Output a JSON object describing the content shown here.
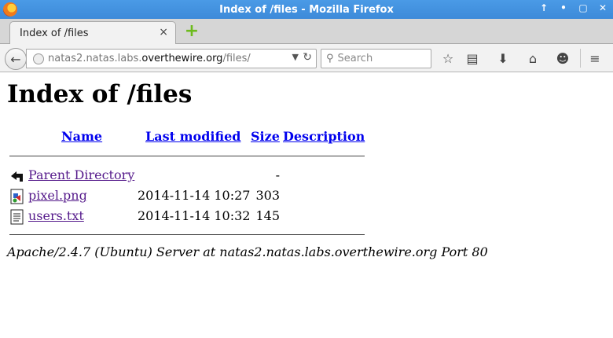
{
  "window": {
    "title": "Index of /files - Mozilla Firefox",
    "buttons": [
      "↑",
      "•",
      "▢",
      "✕"
    ]
  },
  "tab": {
    "label": "Index of /files",
    "close": "×",
    "newtab": "+"
  },
  "navbar": {
    "url_prefix": "natas2.natas.labs.",
    "url_host": "overthewire.org",
    "url_path": "/files/",
    "search_placeholder": "Search"
  },
  "page": {
    "title": "Index of /files",
    "columns": {
      "name": "Name",
      "modified": "Last modified",
      "size": "Size",
      "description": "Description"
    },
    "rows": [
      {
        "name": "Parent Directory",
        "modified": "",
        "size": "-",
        "icon": "back-icon"
      },
      {
        "name": "pixel.png",
        "modified": "2014-11-14 10:27",
        "size": "303",
        "icon": "image-file-icon"
      },
      {
        "name": "users.txt",
        "modified": "2014-11-14 10:32",
        "size": "145",
        "icon": "text-file-icon"
      }
    ],
    "address": "Apache/2.4.7 (Ubuntu) Server at natas2.natas.labs.overthewire.org Port 80"
  },
  "colors": {
    "titlebar": "#3d8ad9",
    "link": "#0000ee",
    "visited_link": "#551a8b"
  }
}
